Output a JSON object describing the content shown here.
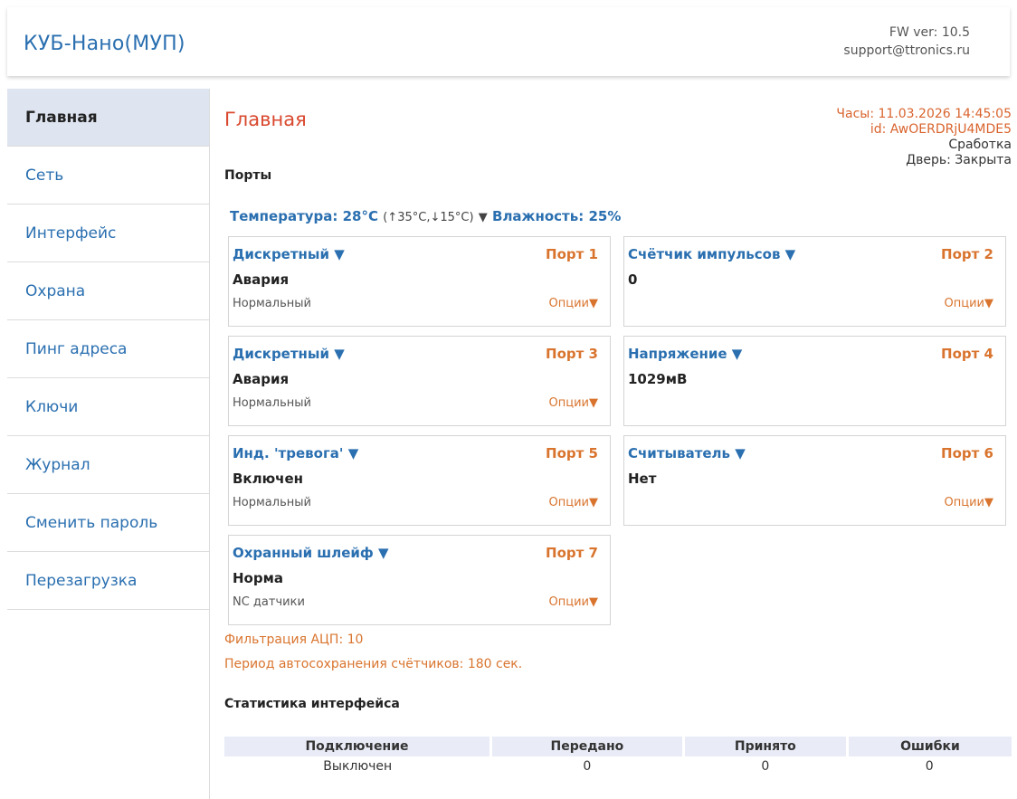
{
  "header": {
    "title": "КУБ-Нано(МУП)",
    "fw": "FW ver: 10.5",
    "support": "support@ttronics.ru"
  },
  "sidebar": {
    "items": [
      {
        "label": "Главная",
        "active": true
      },
      {
        "label": "Сеть"
      },
      {
        "label": "Интерфейс"
      },
      {
        "label": "Охрана"
      },
      {
        "label": "Пинг адреса"
      },
      {
        "label": "Ключи"
      },
      {
        "label": "Журнал"
      },
      {
        "label": "Сменить пароль"
      },
      {
        "label": "Перезагрузка"
      }
    ]
  },
  "main": {
    "title": "Главная",
    "clock": "Часы: 11.03.2026 14:45:05",
    "device_id": "id: AwOERDRjU4MDE5",
    "trigger": "Сработка",
    "door": "Дверь: Закрыта",
    "ports_heading": "Порты",
    "temperature": "Температура: 28°C",
    "temp_limits": "(↑35°C,↓15°C)",
    "temp_arrow": "▼",
    "humidity": "Влажность: 25%",
    "ports": [
      {
        "type": "Дискретный ▼",
        "num": "Порт 1",
        "value": "Авария",
        "mode": "Нормальный",
        "options": "Опции▼"
      },
      {
        "type": "Счётчик импульсов ▼",
        "num": "Порт 2",
        "value": "0",
        "mode": "",
        "options": "Опции▼"
      },
      {
        "type": "Дискретный ▼",
        "num": "Порт 3",
        "value": "Авария",
        "mode": "Нормальный",
        "options": "Опции▼"
      },
      {
        "type": "Напряжение ▼",
        "num": "Порт 4",
        "value": "1029мВ",
        "mode": "",
        "options": ""
      },
      {
        "type": "Инд. 'тревога' ▼",
        "num": "Порт 5",
        "value": "Включен",
        "mode": "Нормальный",
        "options": "Опции▼"
      },
      {
        "type": "Считыватель ▼",
        "num": "Порт 6",
        "value": "Нет",
        "mode": "",
        "options": "Опции▼"
      },
      {
        "type": "Охранный шлейф ▼",
        "num": "Порт 7",
        "value": "Норма",
        "mode": "NC датчики",
        "options": "Опции▼"
      }
    ],
    "adc_filter": "Фильтрация АЦП: 10",
    "autosave": "Период автосохранения счётчиков: 180 сек.",
    "stats_heading": "Статистика интерфейса",
    "stats_columns": [
      "Подключение",
      "Передано",
      "Принято",
      "Ошибки"
    ],
    "stats_row": [
      "Выключен",
      "0",
      "0",
      "0"
    ]
  }
}
